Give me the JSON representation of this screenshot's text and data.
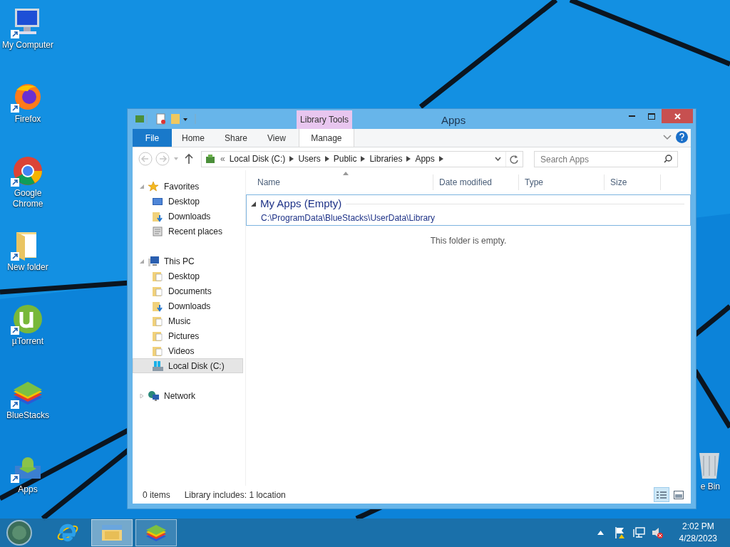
{
  "desktop_icons": [
    {
      "label": "My Computer",
      "kind": "computer"
    },
    {
      "label": "Firefox",
      "kind": "firefox"
    },
    {
      "label": "Google Chrome",
      "kind": "chrome"
    },
    {
      "label": "New folder",
      "kind": "folder"
    },
    {
      "label": "µTorrent",
      "kind": "utorrent"
    },
    {
      "label": "BlueStacks",
      "kind": "bluestacks"
    },
    {
      "label": "Apps",
      "kind": "apps"
    }
  ],
  "recycle_bin": {
    "label": "e Bin"
  },
  "window": {
    "title": "Apps",
    "contextual_group": "Library Tools",
    "ribbon_tabs": [
      {
        "label": "File",
        "kind": "file"
      },
      {
        "label": "Home",
        "kind": "plain"
      },
      {
        "label": "Share",
        "kind": "plain"
      },
      {
        "label": "View",
        "kind": "plain"
      },
      {
        "label": "Manage",
        "kind": "contextual"
      }
    ],
    "address": {
      "overflow": "«",
      "crumbs": [
        "Local Disk (C:)",
        "Users",
        "Public",
        "Libraries",
        "Apps"
      ]
    },
    "search": {
      "placeholder": "Search Apps"
    },
    "nav": [
      {
        "label": "Favorites",
        "kind": "star",
        "expanded": true,
        "selected": false,
        "children": [
          {
            "label": "Desktop",
            "kind": "desktop",
            "selected": false
          },
          {
            "label": "Downloads",
            "kind": "downloads",
            "selected": false
          },
          {
            "label": "Recent places",
            "kind": "recent",
            "selected": false
          }
        ]
      },
      {
        "label": "This PC",
        "kind": "pc",
        "expanded": true,
        "selected": false,
        "children": [
          {
            "label": "Desktop",
            "kind": "folder",
            "selected": false
          },
          {
            "label": "Documents",
            "kind": "folder",
            "selected": false
          },
          {
            "label": "Downloads",
            "kind": "downloads",
            "selected": false
          },
          {
            "label": "Music",
            "kind": "folder",
            "selected": false
          },
          {
            "label": "Pictures",
            "kind": "folder",
            "selected": false
          },
          {
            "label": "Videos",
            "kind": "folder",
            "selected": false
          },
          {
            "label": "Local Disk (C:)",
            "kind": "disk",
            "selected": true
          }
        ]
      },
      {
        "label": "Network",
        "kind": "network",
        "expanded": false,
        "selected": false
      }
    ],
    "columns": [
      "Name",
      "Date modified",
      "Type",
      "Size"
    ],
    "group": {
      "title": "My Apps (Empty)",
      "path": "C:\\ProgramData\\BlueStacks\\UserData\\Library",
      "expanded": true
    },
    "empty_message": "This folder is empty.",
    "status_bar": {
      "count": "0 items",
      "library": "Library includes: 1 location"
    },
    "views": [
      {
        "kind": "details",
        "selected": true
      },
      {
        "kind": "thumbnails",
        "selected": false
      }
    ]
  },
  "taskbar": {
    "apps": [
      {
        "kind": "ie",
        "running": false,
        "active": false
      },
      {
        "kind": "explorer",
        "running": true,
        "active": true
      },
      {
        "kind": "bluestacks",
        "running": true,
        "active": false
      }
    ],
    "clock": {
      "time": "2:02 PM",
      "date": "4/28/2023"
    }
  }
}
